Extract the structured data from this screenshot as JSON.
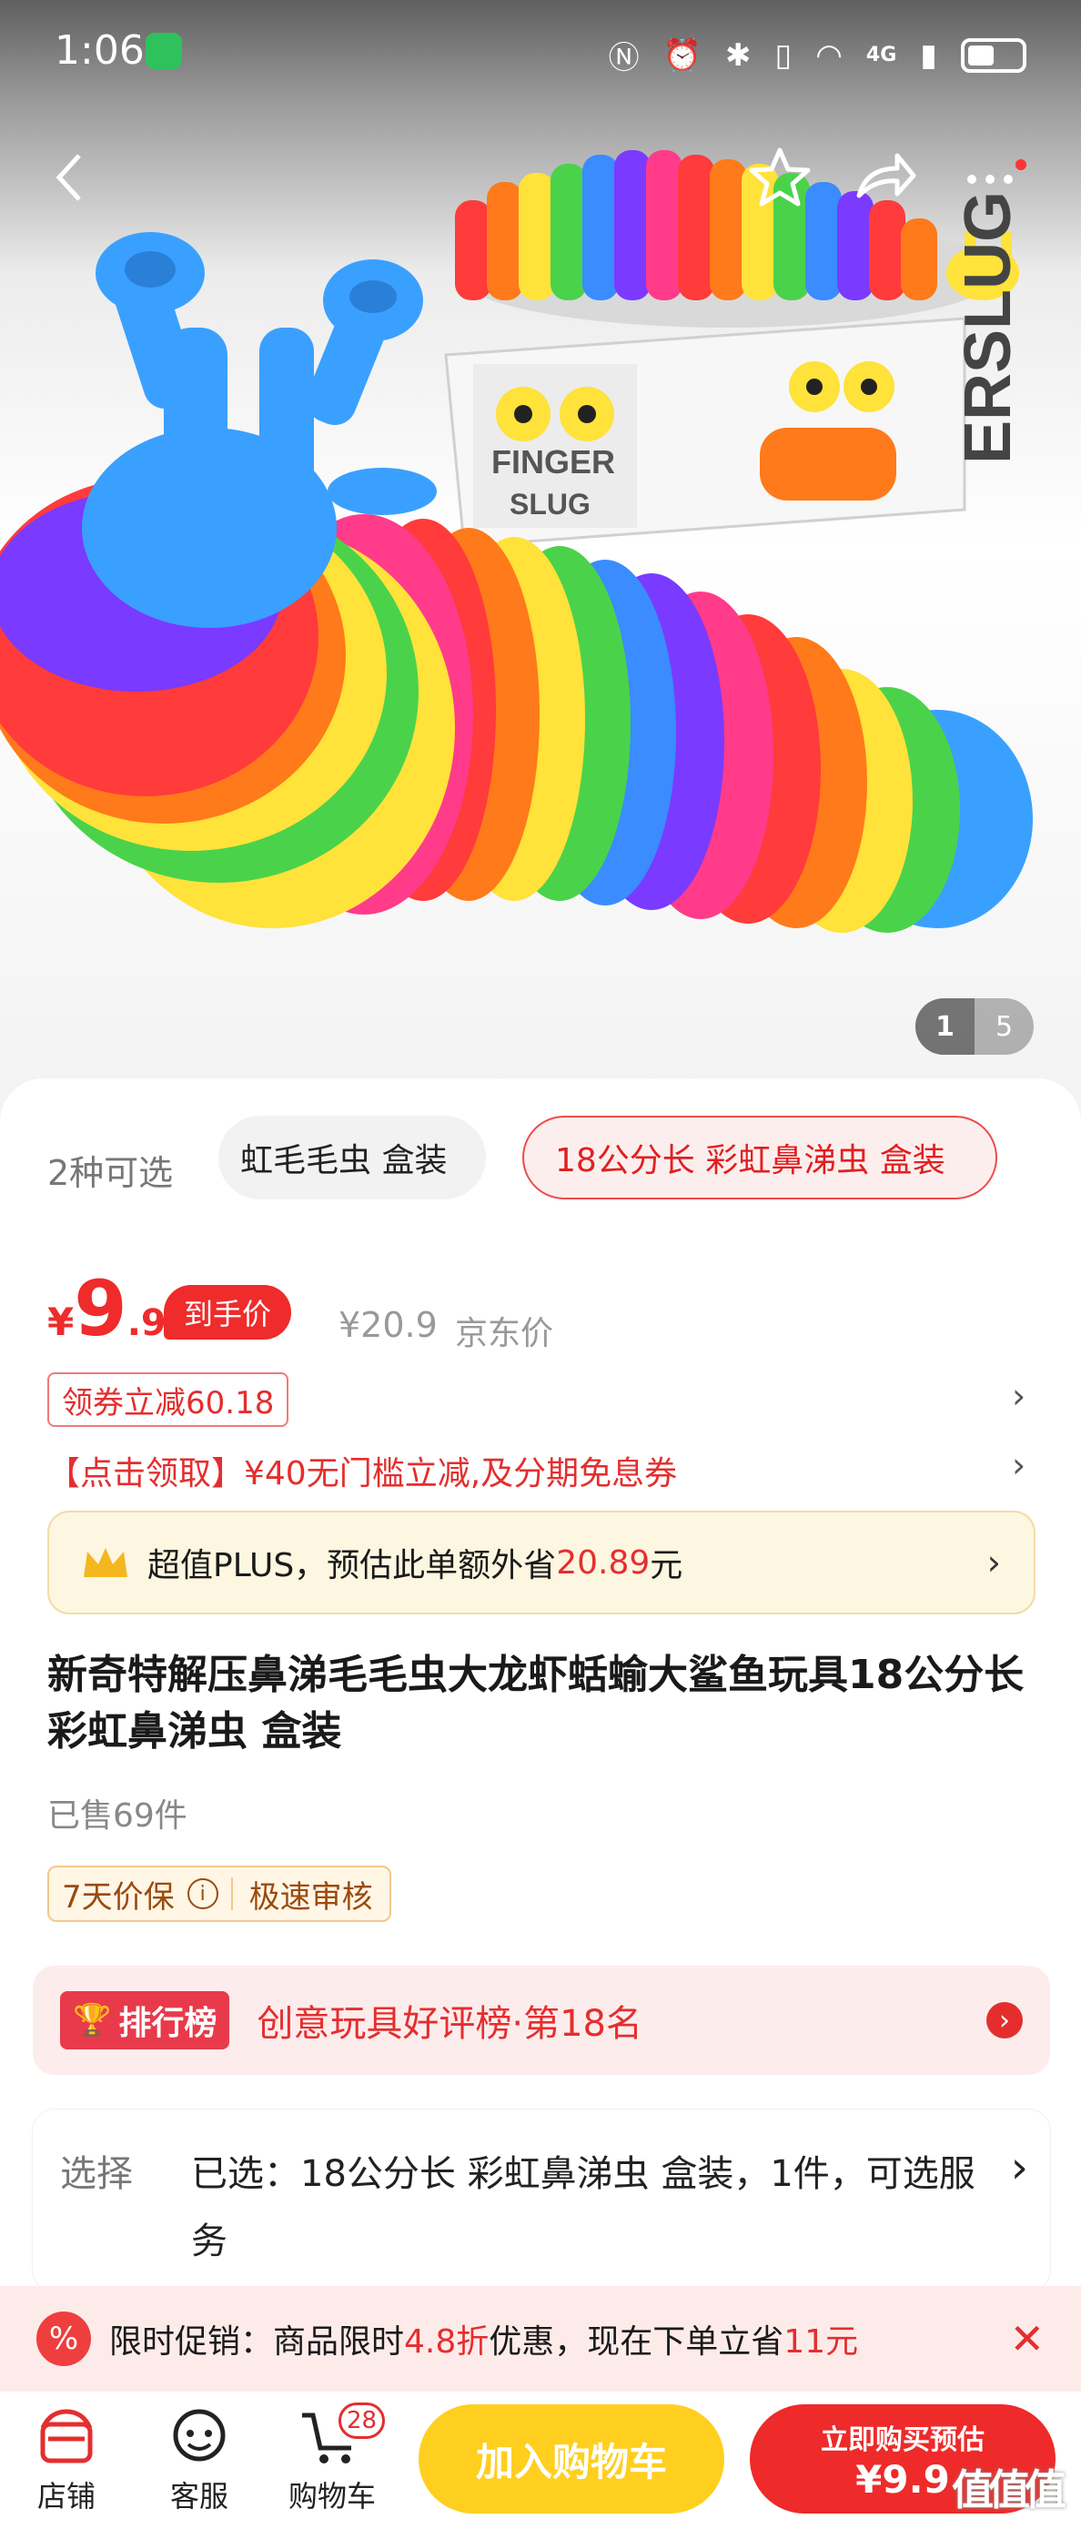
{
  "status_bar": {
    "time": "1:06",
    "network": "4G"
  },
  "gallery": {
    "current": "1",
    "total": "5",
    "box_text_1": "FINGER SLUG",
    "box_text_2": "FINGER",
    "box_text_3": "SLUG",
    "box_text_4": "ERSLUG"
  },
  "variants": {
    "label": "2种可选",
    "option_1": "虹毛毛虫 盒装",
    "option_2": "18公分长 彩虹鼻涕虫 盒装"
  },
  "price": {
    "currency": "¥",
    "integer": "9",
    "decimal": ".9",
    "badge": "到手价",
    "original": "¥20.9",
    "original_label": "京东价"
  },
  "coupon": {
    "label": "领券立减60.18",
    "promo_text": "【点击领取】¥40无门槛立减,及分期免息券"
  },
  "plus": {
    "text": "超值PLUS，预估此单额外省",
    "amount": "20.89",
    "unit": "元"
  },
  "product": {
    "title": "新奇特解压鼻涕毛毛虫大龙虾蛞蝓大鲨鱼玩具18公分长 彩虹鼻涕虫 盒装",
    "sold": "已售69件"
  },
  "tags": {
    "tag1": "7天价保",
    "tag2": "极速审核"
  },
  "rank": {
    "badge": "排行榜",
    "text": "创意玩具好评榜·第18名"
  },
  "selection": {
    "label": "选择",
    "value": "已选：18公分长 彩虹鼻涕虫 盒装，1件，可选服务"
  },
  "promo": {
    "prefix": "限时促销：商品限时",
    "discount": "4.8折",
    "middle": "优惠，现在下单立省",
    "save": "11元"
  },
  "bottom_bar": {
    "store": "店铺",
    "service": "客服",
    "cart": "购物车",
    "cart_count": "28",
    "add_to_cart": "加入购物车",
    "buy_now": "立即购买预估",
    "buy_price": "¥9.9",
    "watermark": "值值值"
  },
  "colors": {
    "accent": "#ee2a2a",
    "gold": "#ffcf1f"
  }
}
